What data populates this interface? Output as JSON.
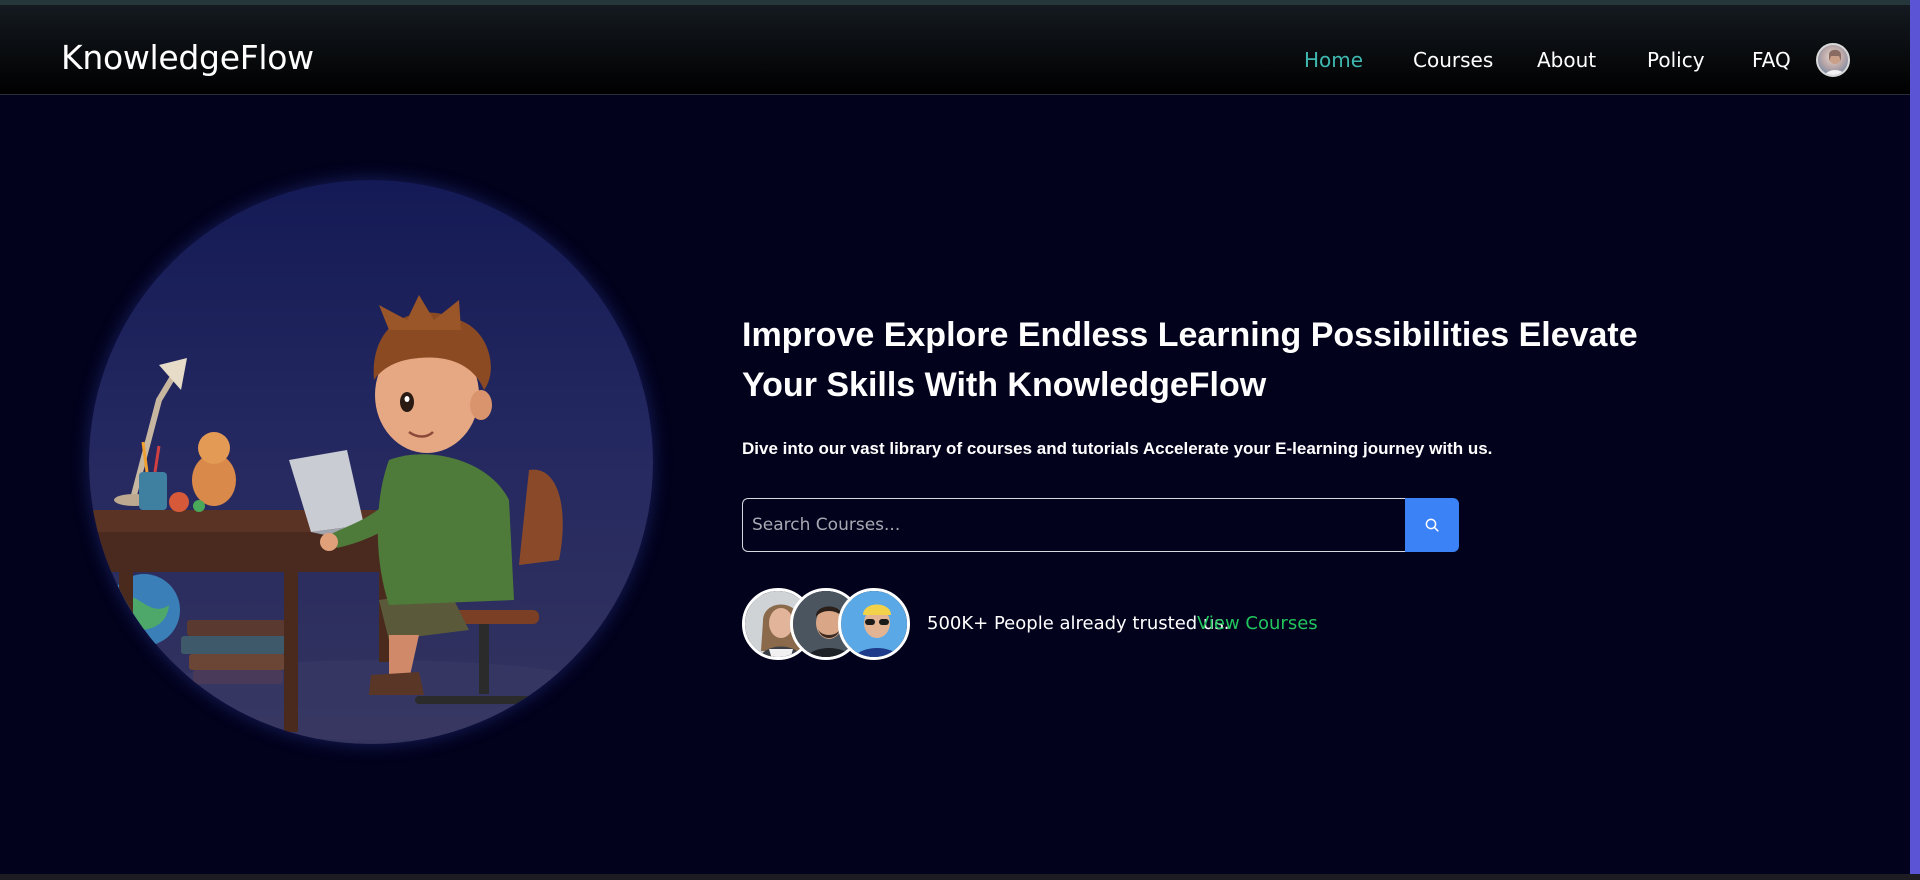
{
  "nav": {
    "brand": "KnowledgeFlow",
    "links": [
      {
        "label": "Home",
        "active": true
      },
      {
        "label": "Courses",
        "active": false
      },
      {
        "label": "About",
        "active": false
      },
      {
        "label": "Policy",
        "active": false
      },
      {
        "label": "FAQ",
        "active": false
      }
    ],
    "active_color": "#3fb8b0"
  },
  "hero": {
    "headline_line1": "Improve Explore Endless Learning Possibilities Elevate",
    "headline_line2": "Your Skills With KnowledgeFlow",
    "subtitle": "Dive into our vast library of courses and tutorials Accelerate your E-learning journey with us.",
    "illustration": "boy-at-desk-with-laptop"
  },
  "search": {
    "placeholder": "Search Courses...",
    "value": "",
    "button_icon": "search-icon",
    "button_color": "#3b82f6"
  },
  "trust": {
    "text": "500K+ People already trusted us.",
    "link": "View Courses",
    "link_color": "#22c55e",
    "avatars": [
      "user-avatar-woman",
      "user-avatar-man-beard",
      "user-avatar-man-sunglasses"
    ]
  },
  "colors": {
    "background": "#02021c",
    "scrollbar": "#5b55d6"
  }
}
